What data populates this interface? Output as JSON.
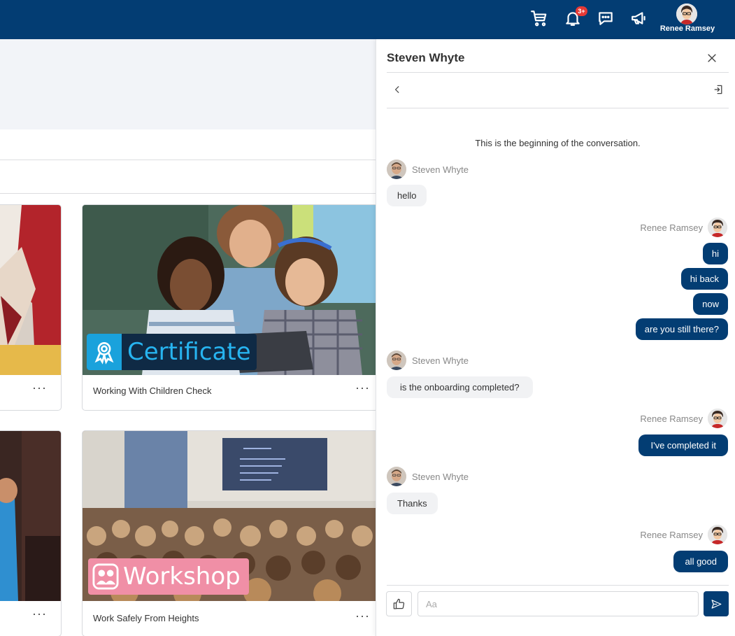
{
  "header": {
    "user_name": "Renee Ramsey",
    "notification_badge": "3+",
    "icons": [
      "cart-icon",
      "bell-icon",
      "chat-bubble-icon",
      "megaphone-icon"
    ]
  },
  "courses": [
    {
      "title": "Working With Children Check",
      "tag": "Certificate",
      "more": "···"
    },
    {
      "title": "Work Safely From Heights",
      "tag": "Workshop",
      "more": "···"
    }
  ],
  "partial_cards": {
    "more": "···"
  },
  "chat": {
    "title": "Steven Whyte",
    "beginning": "This is the beginning of the conversation.",
    "participant": "Steven Whyte",
    "me": "Renee Ramsey",
    "messages": {
      "m1": "hello",
      "m2": "hi",
      "m3": "hi back",
      "m4": "now",
      "m5": "are you still there?",
      "m6": "is the onboarding completed?",
      "m7": "I've completed it",
      "m8": "Thanks",
      "m9": "all good"
    },
    "input_placeholder": "Aa"
  },
  "colors": {
    "brand": "#033d73",
    "badge": "#e53935",
    "cert_accent": "#1aa2dc",
    "workshop_accent": "#f08fa6"
  }
}
